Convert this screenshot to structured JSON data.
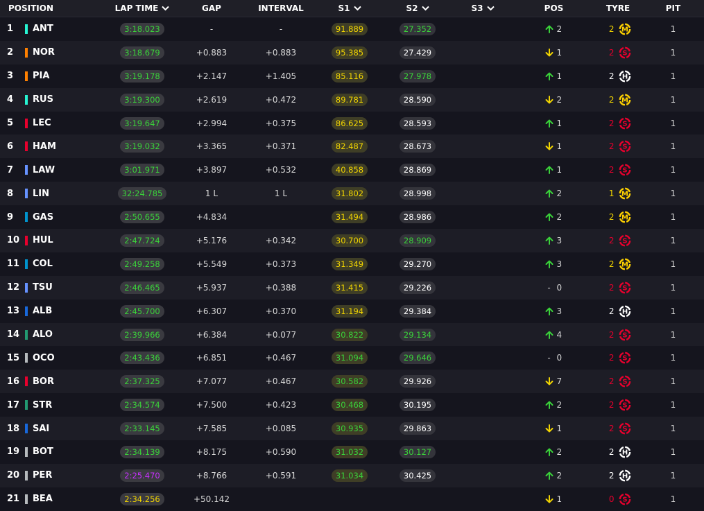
{
  "headers": {
    "position": "POSITION",
    "lap_time": "LAP TIME",
    "gap": "GAP",
    "interval": "INTERVAL",
    "s1": "S1",
    "s2": "S2",
    "s3": "S3",
    "pos": "POS",
    "tyre": "TYRE",
    "pit": "PIT"
  },
  "colors": {
    "background": "#15151e",
    "row_alt": "#1d1d26",
    "green": "#3ad23a",
    "yellow": "#f2d500",
    "purple": "#c830ff",
    "tyre_soft": "#e8002d",
    "tyre_medium": "#ffd200",
    "tyre_hard": "#ffffff"
  },
  "rows": [
    {
      "pos": "1",
      "code": "ANT",
      "team_color": "#27f4d2",
      "lap_time": "3:18.023",
      "lap_color": "green",
      "gap": "-",
      "interval": "-",
      "s1": "91.889",
      "s1_color": "yellow",
      "s2": "27.352",
      "s2_color": "green",
      "move": "up",
      "move_val": "2",
      "tyre_age": "2",
      "tyre_age_color": "yellow",
      "tyre": "M",
      "pit": "1"
    },
    {
      "pos": "2",
      "code": "NOR",
      "team_color": "#ff8000",
      "lap_time": "3:18.679",
      "lap_color": "green",
      "gap": "+0.883",
      "interval": "+0.883",
      "s1": "95.385",
      "s1_color": "yellow",
      "s2": "27.429",
      "s2_color": "white",
      "move": "down",
      "move_val": "1",
      "tyre_age": "2",
      "tyre_age_color": "red",
      "tyre": "S",
      "pit": "1"
    },
    {
      "pos": "3",
      "code": "PIA",
      "team_color": "#ff8000",
      "lap_time": "3:19.178",
      "lap_color": "green",
      "gap": "+2.147",
      "interval": "+1.405",
      "s1": "85.116",
      "s1_color": "yellow",
      "s2": "27.978",
      "s2_color": "green",
      "move": "up",
      "move_val": "1",
      "tyre_age": "2",
      "tyre_age_color": "white",
      "tyre": "H",
      "pit": "1"
    },
    {
      "pos": "4",
      "code": "RUS",
      "team_color": "#27f4d2",
      "lap_time": "3:19.300",
      "lap_color": "green",
      "gap": "+2.619",
      "interval": "+0.472",
      "s1": "89.781",
      "s1_color": "yellow",
      "s2": "28.590",
      "s2_color": "white",
      "move": "down",
      "move_val": "2",
      "tyre_age": "2",
      "tyre_age_color": "yellow",
      "tyre": "M",
      "pit": "1"
    },
    {
      "pos": "5",
      "code": "LEC",
      "team_color": "#e8002d",
      "lap_time": "3:19.647",
      "lap_color": "green",
      "gap": "+2.994",
      "interval": "+0.375",
      "s1": "86.625",
      "s1_color": "yellow",
      "s2": "28.593",
      "s2_color": "white",
      "move": "up",
      "move_val": "1",
      "tyre_age": "2",
      "tyre_age_color": "red",
      "tyre": "S",
      "pit": "1"
    },
    {
      "pos": "6",
      "code": "HAM",
      "team_color": "#e8002d",
      "lap_time": "3:19.032",
      "lap_color": "green",
      "gap": "+3.365",
      "interval": "+0.371",
      "s1": "82.487",
      "s1_color": "yellow",
      "s2": "28.673",
      "s2_color": "white",
      "move": "down",
      "move_val": "1",
      "tyre_age": "2",
      "tyre_age_color": "red",
      "tyre": "S",
      "pit": "1"
    },
    {
      "pos": "7",
      "code": "LAW",
      "team_color": "#6692ff",
      "lap_time": "3:01.971",
      "lap_color": "green",
      "gap": "+3.897",
      "interval": "+0.532",
      "s1": "40.858",
      "s1_color": "yellow",
      "s2": "28.869",
      "s2_color": "white",
      "move": "up",
      "move_val": "1",
      "tyre_age": "2",
      "tyre_age_color": "red",
      "tyre": "S",
      "pit": "1"
    },
    {
      "pos": "8",
      "code": "LIN",
      "team_color": "#6692ff",
      "lap_time": "32:24.785",
      "lap_color": "green",
      "gap": "1 L",
      "interval": "1 L",
      "s1": "31.802",
      "s1_color": "yellow",
      "s2": "28.998",
      "s2_color": "white",
      "move": "up",
      "move_val": "2",
      "tyre_age": "1",
      "tyre_age_color": "yellow",
      "tyre": "M",
      "pit": "1"
    },
    {
      "pos": "9",
      "code": "GAS",
      "team_color": "#0093cc",
      "lap_time": "2:50.655",
      "lap_color": "green",
      "gap": "+4.834",
      "interval": "",
      "s1": "31.494",
      "s1_color": "yellow",
      "s2": "28.986",
      "s2_color": "white",
      "move": "up",
      "move_val": "2",
      "tyre_age": "2",
      "tyre_age_color": "yellow",
      "tyre": "M",
      "pit": "1"
    },
    {
      "pos": "10",
      "code": "HUL",
      "team_color": "#e8002d",
      "lap_time": "2:47.724",
      "lap_color": "green",
      "gap": "+5.176",
      "interval": "+0.342",
      "s1": "30.700",
      "s1_color": "yellow",
      "s2": "28.909",
      "s2_color": "green",
      "move": "up",
      "move_val": "3",
      "tyre_age": "2",
      "tyre_age_color": "red",
      "tyre": "S",
      "pit": "1"
    },
    {
      "pos": "11",
      "code": "COL",
      "team_color": "#0093cc",
      "lap_time": "2:49.258",
      "lap_color": "green",
      "gap": "+5.549",
      "interval": "+0.373",
      "s1": "31.349",
      "s1_color": "yellow",
      "s2": "29.270",
      "s2_color": "white",
      "move": "up",
      "move_val": "3",
      "tyre_age": "2",
      "tyre_age_color": "yellow",
      "tyre": "M",
      "pit": "1"
    },
    {
      "pos": "12",
      "code": "TSU",
      "team_color": "#6692ff",
      "lap_time": "2:46.465",
      "lap_color": "green",
      "gap": "+5.937",
      "interval": "+0.388",
      "s1": "31.415",
      "s1_color": "yellow",
      "s2": "29.226",
      "s2_color": "white",
      "move": "same",
      "move_val": "0",
      "tyre_age": "2",
      "tyre_age_color": "red",
      "tyre": "S",
      "pit": "1"
    },
    {
      "pos": "13",
      "code": "ALB",
      "team_color": "#1868db",
      "lap_time": "2:45.700",
      "lap_color": "green",
      "gap": "+6.307",
      "interval": "+0.370",
      "s1": "31.194",
      "s1_color": "yellow",
      "s2": "29.384",
      "s2_color": "white",
      "move": "up",
      "move_val": "3",
      "tyre_age": "2",
      "tyre_age_color": "white",
      "tyre": "H",
      "pit": "1"
    },
    {
      "pos": "14",
      "code": "ALO",
      "team_color": "#229971",
      "lap_time": "2:39.966",
      "lap_color": "green",
      "gap": "+6.384",
      "interval": "+0.077",
      "s1": "30.822",
      "s1_color": "green",
      "s2": "29.134",
      "s2_color": "green",
      "move": "up",
      "move_val": "4",
      "tyre_age": "2",
      "tyre_age_color": "red",
      "tyre": "S",
      "pit": "1"
    },
    {
      "pos": "15",
      "code": "OCO",
      "team_color": "#b6babd",
      "lap_time": "2:43.436",
      "lap_color": "green",
      "gap": "+6.851",
      "interval": "+0.467",
      "s1": "31.094",
      "s1_color": "green",
      "s2": "29.646",
      "s2_color": "green",
      "move": "same",
      "move_val": "0",
      "tyre_age": "2",
      "tyre_age_color": "red",
      "tyre": "S",
      "pit": "1"
    },
    {
      "pos": "16",
      "code": "BOR",
      "team_color": "#e8002d",
      "lap_time": "2:37.325",
      "lap_color": "green",
      "gap": "+7.077",
      "interval": "+0.467",
      "s1": "30.582",
      "s1_color": "green",
      "s2": "29.926",
      "s2_color": "white",
      "move": "down",
      "move_val": "7",
      "tyre_age": "2",
      "tyre_age_color": "red",
      "tyre": "S",
      "pit": "1"
    },
    {
      "pos": "17",
      "code": "STR",
      "team_color": "#229971",
      "lap_time": "2:34.574",
      "lap_color": "green",
      "gap": "+7.500",
      "interval": "+0.423",
      "s1": "30.468",
      "s1_color": "green",
      "s2": "30.195",
      "s2_color": "white",
      "move": "up",
      "move_val": "2",
      "tyre_age": "2",
      "tyre_age_color": "red",
      "tyre": "S",
      "pit": "1"
    },
    {
      "pos": "18",
      "code": "SAI",
      "team_color": "#1868db",
      "lap_time": "2:33.145",
      "lap_color": "green",
      "gap": "+7.585",
      "interval": "+0.085",
      "s1": "30.935",
      "s1_color": "green",
      "s2": "29.863",
      "s2_color": "white",
      "move": "down",
      "move_val": "1",
      "tyre_age": "2",
      "tyre_age_color": "red",
      "tyre": "S",
      "pit": "1"
    },
    {
      "pos": "19",
      "code": "BOT",
      "team_color": "#b6babd",
      "lap_time": "2:34.139",
      "lap_color": "green",
      "gap": "+8.175",
      "interval": "+0.590",
      "s1": "31.032",
      "s1_color": "green",
      "s2": "30.127",
      "s2_color": "green",
      "move": "up",
      "move_val": "2",
      "tyre_age": "2",
      "tyre_age_color": "white",
      "tyre": "H",
      "pit": "1"
    },
    {
      "pos": "20",
      "code": "PER",
      "team_color": "#b6babd",
      "lap_time": "2:25.470",
      "lap_color": "purple",
      "gap": "+8.766",
      "interval": "+0.591",
      "s1": "31.034",
      "s1_color": "green",
      "s2": "30.425",
      "s2_color": "white",
      "move": "up",
      "move_val": "2",
      "tyre_age": "2",
      "tyre_age_color": "white",
      "tyre": "H",
      "pit": "1"
    },
    {
      "pos": "21",
      "code": "BEA",
      "team_color": "#b6babd",
      "lap_time": "2:34.256",
      "lap_color": "yellow",
      "gap": "+50.142",
      "interval": "",
      "s1": "",
      "s1_color": "yellow",
      "s2": "",
      "s2_color": "white",
      "move": "down",
      "move_val": "1",
      "tyre_age": "0",
      "tyre_age_color": "red",
      "tyre": "S",
      "pit": "1"
    }
  ]
}
